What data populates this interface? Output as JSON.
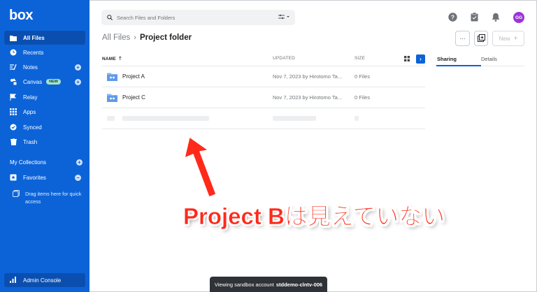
{
  "app": {
    "logo": "box"
  },
  "sidebar": {
    "items": [
      {
        "label": "All Files",
        "icon": "folder-icon",
        "active": true
      },
      {
        "label": "Recents",
        "icon": "clock-icon"
      },
      {
        "label": "Notes",
        "icon": "notes-icon",
        "plus": true
      },
      {
        "label": "Canvas",
        "icon": "canvas-icon",
        "badge": "NEW",
        "plus": true
      },
      {
        "label": "Relay",
        "icon": "relay-icon"
      },
      {
        "label": "Apps",
        "icon": "grid-icon"
      },
      {
        "label": "Synced",
        "icon": "check-circle-icon"
      },
      {
        "label": "Trash",
        "icon": "trash-icon"
      }
    ],
    "collections_label": "My Collections",
    "favorites_label": "Favorites",
    "drag_hint": "Drag items here for quick access",
    "admin_label": "Admin Console"
  },
  "search": {
    "placeholder": "Search Files and Folders"
  },
  "header": {
    "avatar_initials": "GG"
  },
  "breadcrumb": {
    "root": "All Files",
    "current": "Project folder"
  },
  "toolbar": {
    "more_label": "···",
    "new_label": "New"
  },
  "table": {
    "columns": {
      "name": "NAME",
      "updated": "UPDATED",
      "size": "SIZE"
    },
    "rows": [
      {
        "name": "Project A",
        "updated": "Nov 7, 2023 by Hirotomo Ta...",
        "size": "0 Files"
      },
      {
        "name": "Project C",
        "updated": "Nov 7, 2023 by Hirotomo Ta...",
        "size": "0 Files"
      }
    ]
  },
  "panel": {
    "tabs": [
      "Sharing",
      "Details"
    ]
  },
  "annotation": {
    "text": "Project Bは見えていない"
  },
  "toast": {
    "prefix": "Viewing sandbox account",
    "account": "stddemo-clntv-006"
  },
  "colors": {
    "brand": "#0c63d8",
    "annotation": "#ff2a1a",
    "avatar": "#9b35d6"
  }
}
